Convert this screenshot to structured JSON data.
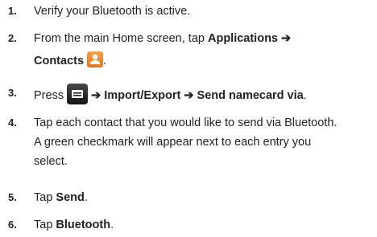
{
  "arrow": "➔",
  "steps": [
    {
      "number": "1.",
      "text": "Verify your Bluetooth is active."
    },
    {
      "number": "2.",
      "prefix": "From the main Home screen, tap ",
      "bold1": "Applications",
      "bold2": "Contacts",
      "suffix": ".",
      "icon": "contacts-icon"
    },
    {
      "number": "3.",
      "prefix": "Press",
      "icon": "menu-key-icon",
      "bold1": "Import/Export",
      "bold2": "Send namecard via",
      "suffix": "."
    },
    {
      "number": "4.",
      "lines": [
        "Tap each contact that you would like to send via Bluetooth.",
        "A green checkmark will appear next to each entry you",
        "select."
      ]
    },
    {
      "number": "5.",
      "prefix": "Tap ",
      "bold": "Send",
      "suffix": "."
    },
    {
      "number": "6.",
      "prefix": "Tap ",
      "bold": "Bluetooth",
      "suffix": "."
    }
  ],
  "colors": {
    "contacts_icon": "#ee8a31",
    "menu_key": "#2a2a2a"
  }
}
